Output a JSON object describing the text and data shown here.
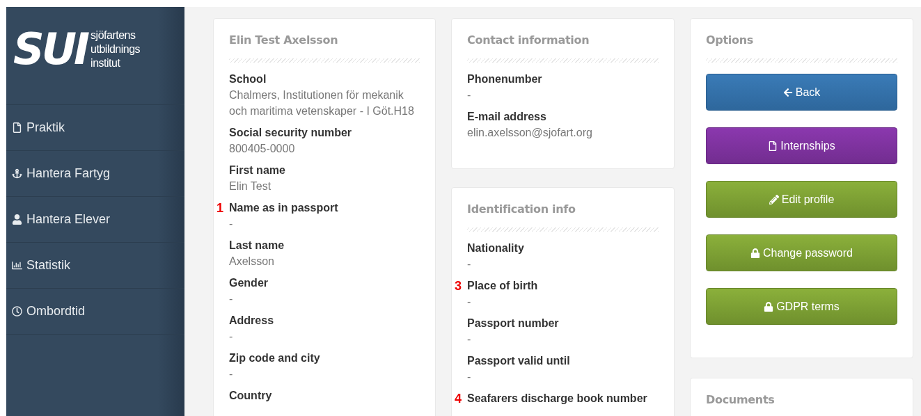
{
  "logo": {
    "mark": "SUI",
    "lines": [
      "sjöfartens",
      "utbildnings",
      "institut"
    ]
  },
  "sidebar": {
    "items": [
      {
        "label": "Praktik"
      },
      {
        "label": "Hantera Fartyg"
      },
      {
        "label": "Hantera Elever"
      },
      {
        "label": "Statistik"
      },
      {
        "label": "Ombordtid"
      }
    ]
  },
  "profile_card": {
    "title": "Elin Test Axelsson",
    "fields": [
      {
        "label": "School",
        "value": "Chalmers, Institutionen för mekanik och maritima vetenskaper - I Göt.H18"
      },
      {
        "label": "Social security number",
        "value": "800405-0000"
      },
      {
        "label": "First name",
        "value": "Elin Test"
      },
      {
        "label": "Name as in passport",
        "value": "-",
        "marker": "1"
      },
      {
        "label": "Last name",
        "value": "Axelsson"
      },
      {
        "label": "Gender",
        "value": "-"
      },
      {
        "label": "Address",
        "value": "-"
      },
      {
        "label": "Zip code and city",
        "value": "-"
      },
      {
        "label": "Country"
      }
    ]
  },
  "contact_card": {
    "title": "Contact information",
    "fields": [
      {
        "label": "Phonenumber",
        "value": "-"
      },
      {
        "label": "E-mail address",
        "value": "elin.axelsson@sjofart.org"
      }
    ]
  },
  "identification_card": {
    "title": "Identification info",
    "fields": [
      {
        "label": "Nationality",
        "value": "-"
      },
      {
        "label": "Place of birth",
        "value": "-",
        "marker": "3"
      },
      {
        "label": "Passport number",
        "value": "-"
      },
      {
        "label": "Passport valid until",
        "value": "-"
      },
      {
        "label": "Seafarers discharge book number",
        "marker": "4"
      }
    ]
  },
  "options_card": {
    "title": "Options",
    "buttons": [
      {
        "label": "Back",
        "kind": "primary"
      },
      {
        "label": "Internships",
        "kind": "purple"
      },
      {
        "label": "Edit profile",
        "kind": "success"
      },
      {
        "label": "Change password",
        "kind": "success"
      },
      {
        "label": "GDPR terms",
        "kind": "success"
      }
    ]
  },
  "documents_card": {
    "title": "Documents"
  }
}
